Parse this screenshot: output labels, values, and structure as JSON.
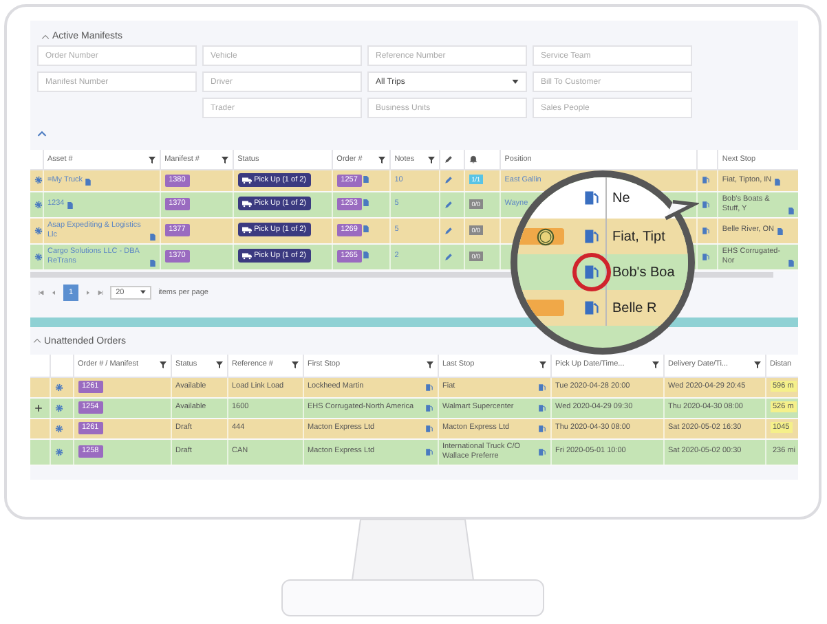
{
  "section_title": "Active Manifests",
  "filter_rows": [
    [
      {
        "kind": "text",
        "placeholder": "Order Number"
      },
      {
        "kind": "text",
        "placeholder": "Vehicle"
      },
      {
        "kind": "text",
        "placeholder": "Reference Number"
      },
      {
        "kind": "text",
        "placeholder": "Service Team"
      }
    ],
    [
      {
        "kind": "text",
        "placeholder": "Manifest Number"
      },
      {
        "kind": "text",
        "placeholder": "Driver"
      },
      {
        "kind": "select",
        "value": "All Trips"
      },
      {
        "kind": "text",
        "placeholder": "Bill To Customer"
      }
    ],
    [
      {
        "kind": "text",
        "placeholder": "Trader"
      },
      {
        "kind": "text",
        "placeholder": "Business Units"
      },
      {
        "kind": "text",
        "placeholder": "Sales People"
      }
    ]
  ],
  "manifest_table": {
    "columns": [
      {
        "label": "Asset #",
        "filter": true
      },
      {
        "label": "Manifest #",
        "filter": true
      },
      {
        "label": "Status",
        "filter": false
      },
      {
        "label": "Order #",
        "filter": true
      },
      {
        "label": "Notes",
        "filter": true
      },
      {
        "label": "Position",
        "filter": false
      },
      {
        "label": "Next Stop",
        "filter": false
      }
    ],
    "rows": [
      {
        "asset": "=My Truck",
        "manifest": "1380",
        "status": "Pick Up (1 of 2)",
        "order": "1257",
        "notes": "10",
        "alerts": "1/1",
        "alerts_active": true,
        "position": "East Gallin",
        "next_stop": "Fiat, Tipton, IN",
        "color": "#efdca4"
      },
      {
        "asset": "1234",
        "manifest": "1370",
        "status": "Pick Up (1 of 2)",
        "order": "1253",
        "notes": "5",
        "alerts": "0/0",
        "alerts_active": false,
        "position": "Wayne",
        "next_stop": "Bob's Boats & Stuff, Y",
        "color": "#c5e4b5"
      },
      {
        "asset": "Asap Expediting & Logistics Llc",
        "manifest": "1377",
        "status": "Pick Up (1 of 2)",
        "order": "1269",
        "notes": "5",
        "alerts": "0/0",
        "alerts_active": false,
        "next_stop": "Belle River, ON",
        "color": "#efdca4"
      },
      {
        "asset": "Cargo Solutions LLC - DBA ReTrans",
        "manifest": "1370",
        "status": "Pick Up (1 of 2)",
        "order": "1265",
        "notes": "2",
        "alerts": "0/0",
        "alerts_active": false,
        "next_stop": "EHS Corrugated-Nor",
        "color": "#c5e4b5"
      }
    ]
  },
  "pager": {
    "pages": [
      {
        "label": "1",
        "selected": true
      }
    ],
    "page_size": "20",
    "page_size_label": "items per page"
  },
  "unattended": {
    "title": "Unattended Orders",
    "columns": [
      {
        "label": "Order # / Manifest",
        "filter": true
      },
      {
        "label": "Status",
        "filter": true
      },
      {
        "label": "Reference #",
        "filter": true
      },
      {
        "label": "First Stop",
        "filter": true
      },
      {
        "label": "Last Stop",
        "filter": true
      },
      {
        "label": "Pick Up Date/Time...",
        "filter": true
      },
      {
        "label": "Delivery Date/Ti...",
        "filter": true
      },
      {
        "label": "Distan",
        "filter": false
      }
    ],
    "rows": [
      {
        "expandable": false,
        "order": "1261",
        "status": "Available",
        "reference": "Load Link Load",
        "first_stop": "Lockheed Martin",
        "last_stop": "Fiat",
        "pickup": "Tue 2020-04-28 20:00",
        "delivery": "Wed 2020-04-29 20:45",
        "distance": "596 m",
        "highlight": true,
        "color": "#efdca4"
      },
      {
        "expandable": true,
        "order": "1254",
        "status": "Available",
        "reference": "1600",
        "first_stop": "EHS Corrugated-North America",
        "last_stop": "Walmart Supercenter",
        "pickup": "Wed 2020-04-29 09:30",
        "delivery": "Thu 2020-04-30 08:00",
        "distance": "526 m",
        "highlight": true,
        "color": "#c5e4b5"
      },
      {
        "expandable": false,
        "order": "1261",
        "status": "Draft",
        "reference": "444",
        "first_stop": "Macton Express Ltd",
        "last_stop": "Macton Express Ltd",
        "pickup": "Thu 2020-04-30 08:00",
        "delivery": "Sat 2020-05-02 16:30",
        "distance": "1045",
        "highlight": true,
        "color": "#efdca4"
      },
      {
        "expandable": false,
        "order": "1258",
        "status": "Draft",
        "reference": "CAN",
        "first_stop": "Macton Express Ltd",
        "last_stop": "International Truck C/O Wallace Preferre",
        "pickup": "Fri 2020-05-01 10:00",
        "delivery": "Sat 2020-05-02 00:30",
        "distance": "236 mi",
        "highlight": false,
        "color": "#c5e4b5"
      }
    ]
  },
  "magnifier": {
    "rows": [
      {
        "text": "Ne",
        "color": "#ffffff",
        "tag": false,
        "m_icon": false,
        "ringed": false
      },
      {
        "text": "Fiat, Tipt",
        "color": "#efdca4",
        "tag": true,
        "m_icon": true,
        "ringed": false
      },
      {
        "text": "Bob's Boa",
        "color": "#c5e4b5",
        "tag": false,
        "m_icon": false,
        "ringed": true
      },
      {
        "text": "Belle R",
        "color": "#efdca4",
        "tag": true,
        "m_icon": false,
        "ringed": false
      }
    ]
  }
}
